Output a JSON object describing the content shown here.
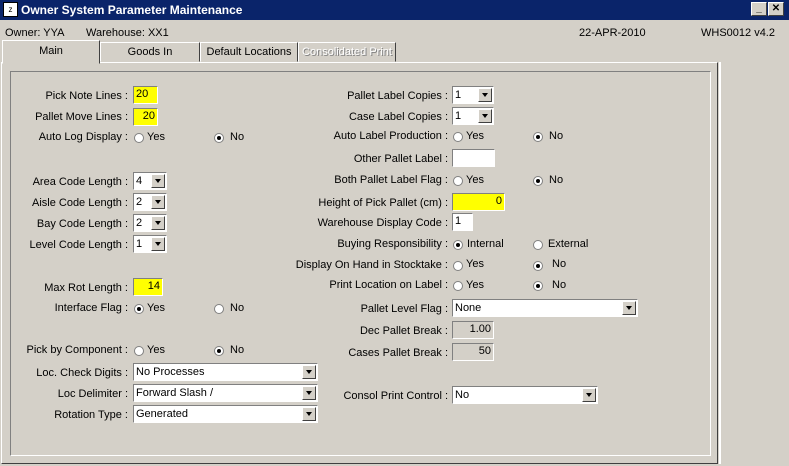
{
  "window": {
    "title": "Owner System Parameter Maintenance",
    "app_icon_text": "ᴢ",
    "minimize": "_",
    "close": "✕"
  },
  "info": {
    "owner": "Owner:  YYA",
    "warehouse": "Warehouse:  XX1",
    "date": "22-APR-2010",
    "version": "WHS0012  v4.2"
  },
  "tabs": [
    "Main",
    "Goods In",
    "Default Locations",
    "Consolidated Print"
  ],
  "left": {
    "pick_note_lines": {
      "label": "Pick Note Lines :",
      "value": "20"
    },
    "pallet_move_lines": {
      "label": "Pallet Move Lines :",
      "value": "20"
    },
    "auto_log_display": {
      "label": "Auto Log Display :",
      "yes": "Yes",
      "no": "No"
    },
    "area_code_length": {
      "label": "Area Code Length :",
      "value": "4"
    },
    "aisle_code_length": {
      "label": "Aisle Code Length :",
      "value": "2"
    },
    "bay_code_length": {
      "label": "Bay Code Length :",
      "value": "2"
    },
    "level_code_length": {
      "label": "Level Code Length :",
      "value": "1"
    },
    "max_rot_length": {
      "label": "Max Rot Length :",
      "value": "14"
    },
    "interface_flag": {
      "label": "Interface Flag :",
      "yes": "Yes",
      "no": "No"
    },
    "pick_by_component": {
      "label": "Pick by Component :",
      "yes": "Yes",
      "no": "No"
    },
    "loc_check_digits": {
      "label": "Loc. Check Digits :",
      "value": "No Processes"
    },
    "loc_delimiter": {
      "label": "Loc Delimiter :",
      "value": "Forward Slash  /"
    },
    "rotation_type": {
      "label": "Rotation Type :",
      "value": "Generated"
    }
  },
  "right": {
    "pallet_label_copies": {
      "label": "Pallet Label Copies :",
      "value": "1"
    },
    "case_label_copies": {
      "label": "Case Label Copies :",
      "value": "1"
    },
    "auto_label_production": {
      "label": "Auto Label Production :",
      "yes": "Yes",
      "no": "No"
    },
    "other_pallet_label": {
      "label": "Other Pallet Label :",
      "value": ""
    },
    "both_pallet_label_flag": {
      "label": "Both Pallet Label Flag :",
      "yes": "Yes",
      "no": "No"
    },
    "height_of_pick_pallet": {
      "label": "Height of Pick Pallet (cm) :",
      "value": "0"
    },
    "warehouse_display_code": {
      "label": "Warehouse Display Code :",
      "value": "1"
    },
    "buying_responsibility": {
      "label": "Buying Responsibility :",
      "internal": "Internal",
      "external": "External"
    },
    "display_on_hand": {
      "label": "Display On Hand in Stocktake :",
      "yes": "Yes",
      "no": "No"
    },
    "print_location_on_label": {
      "label": "Print Location on Label :",
      "yes": "Yes",
      "no": "No"
    },
    "pallet_level_flag": {
      "label": "Pallet Level Flag :",
      "value": "None"
    },
    "dec_pallet_break": {
      "label": "Dec Pallet Break :",
      "value": "1.00"
    },
    "cases_pallet_break": {
      "label": "Cases Pallet Break :",
      "value": "50"
    },
    "consol_print_control": {
      "label": "Consol Print Control :",
      "value": "No"
    }
  },
  "colors": {
    "titlebar": "#0a246a",
    "face": "#d4d0c8",
    "highlight_field": "#ffff00"
  }
}
